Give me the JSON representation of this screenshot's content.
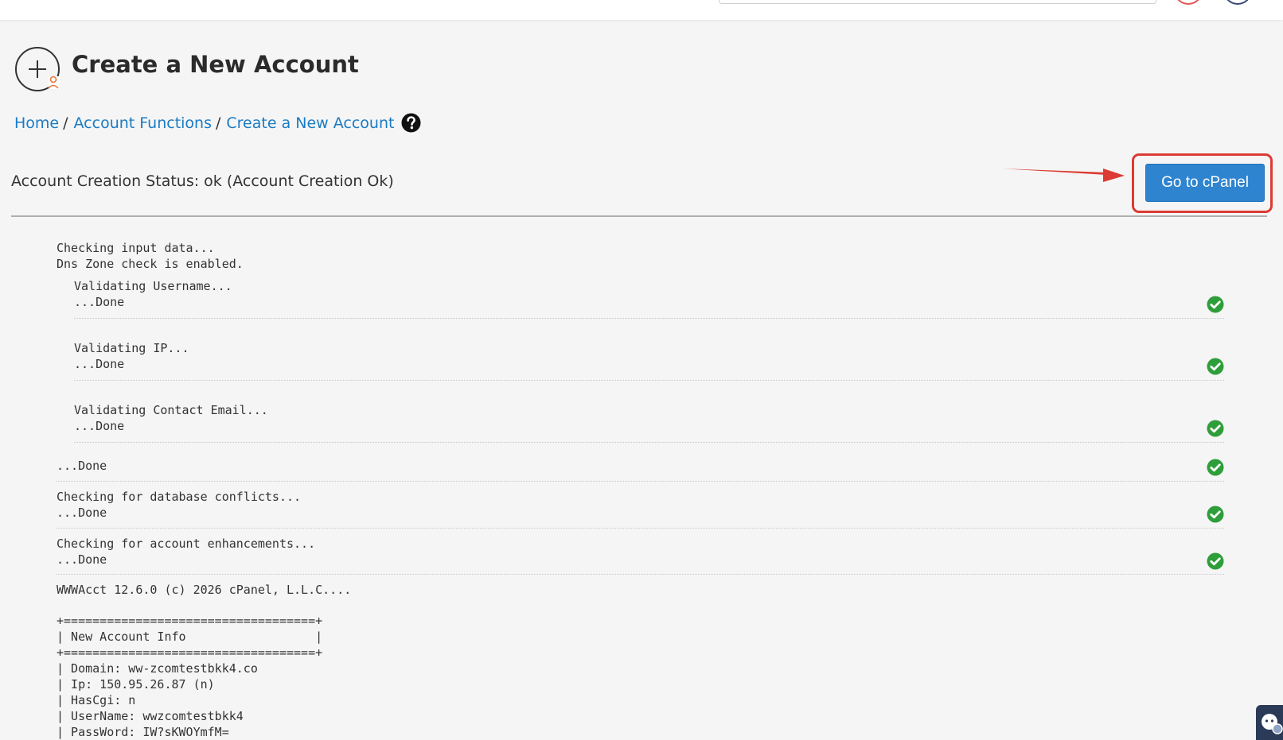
{
  "header": {
    "title": "Create a New Account",
    "title_icon": "add-account-icon"
  },
  "breadcrumb": {
    "items": [
      "Home",
      "Account Functions",
      "Create a New Account"
    ],
    "separator": "/",
    "help_icon": "help-circle-icon"
  },
  "status": {
    "text": "Account Creation Status: ok (Account Creation Ok)"
  },
  "actions": {
    "go_to_cpanel": "Go to cPanel"
  },
  "log": {
    "intro": [
      "Checking input data...",
      "Dns Zone check is enabled."
    ],
    "sub_steps": [
      {
        "label": "Validating Username...",
        "result": "...Done"
      },
      {
        "label": "Validating IP...",
        "result": "...Done"
      },
      {
        "label": "Validating Contact Email...",
        "result": "...Done"
      }
    ],
    "done": "...Done",
    "steps": [
      {
        "label": "Checking for database conflicts...",
        "result": "...Done"
      },
      {
        "label": "Checking for account enhancements...",
        "result": "...Done"
      }
    ],
    "copyright": "WWWAcct 12.6.0 (c) 2026 cPanel, L.L.C....",
    "info_table": [
      "+===================================+",
      "| New Account Info                  |",
      "+===================================+",
      "| Domain: ww-zcomtestbkk4.co",
      "| Ip: 150.95.26.87 (n)",
      "| HasCgi: n",
      "| UserName: wwzcomtestbkk4",
      "| PassWord: IW?sKWOYmfM="
    ]
  },
  "colors": {
    "link": "#1a7bc4",
    "button": "#2f84cf",
    "highlight": "#dc3b33",
    "check": "#2e9e3a"
  }
}
